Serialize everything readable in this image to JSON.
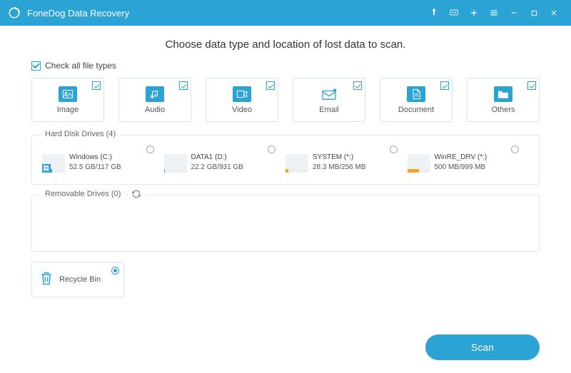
{
  "titlebar": {
    "title": "FoneDog Data Recovery"
  },
  "heading": "Choose data type and location of lost data to scan.",
  "checkAllLabel": "Check all file types",
  "types": [
    {
      "label": "Image"
    },
    {
      "label": "Audio"
    },
    {
      "label": "Video"
    },
    {
      "label": "Email"
    },
    {
      "label": "Document"
    },
    {
      "label": "Others"
    }
  ],
  "hardDiskSection": "Hard Disk Drives (4)",
  "drives": [
    {
      "name": "Windows (C:)",
      "size": "52.5 GB/117 GB",
      "color": "#2ba3d4",
      "fill": 45,
      "os": true
    },
    {
      "name": "DATA1 (D:)",
      "size": "22.2 GB/931 GB",
      "color": "#2ba3d4",
      "fill": 5,
      "os": false
    },
    {
      "name": "SYSTEM (*:)",
      "size": "28.3 MB/256 MB",
      "color": "#f5a623",
      "fill": 12,
      "os": false
    },
    {
      "name": "WinRE_DRV (*:)",
      "size": "500 MB/999 MB",
      "color": "#f5a623",
      "fill": 50,
      "os": false
    }
  ],
  "removableSection": "Removable Drives (0)",
  "recycle": {
    "label": "Recycle Bin"
  },
  "scanLabel": "Scan"
}
